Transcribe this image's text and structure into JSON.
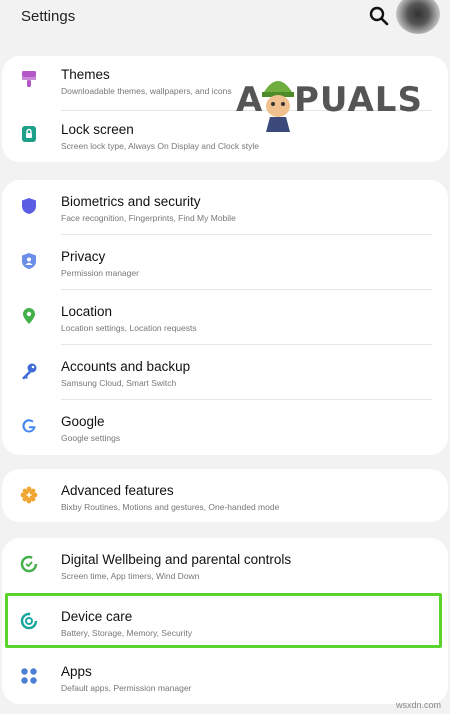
{
  "header": {
    "title": "Settings",
    "search_icon": "search-icon",
    "avatar_icon": "profile-avatar"
  },
  "watermark": {
    "a": "A",
    "rest": "PUALS"
  },
  "groups": [
    {
      "items": [
        {
          "title": "Themes",
          "subtitle": "Downloadable themes, wallpapers, and icons",
          "icon": "themes-brush-icon",
          "color": "#b357c9"
        },
        {
          "title": "Lock screen",
          "subtitle": "Screen lock type, Always On Display and Clock style",
          "icon": "lock-icon",
          "color": "#1e9f8a"
        }
      ]
    },
    {
      "items": [
        {
          "title": "Biometrics and security",
          "subtitle": "Face recognition, Fingerprints, Find My Mobile",
          "icon": "shield-icon",
          "color": "#5b5ee3"
        },
        {
          "title": "Privacy",
          "subtitle": "Permission manager",
          "icon": "privacy-shield-icon",
          "color": "#6b8ee8"
        },
        {
          "title": "Location",
          "subtitle": "Location settings, Location requests",
          "icon": "location-pin-icon",
          "color": "#43b04a"
        },
        {
          "title": "Accounts and backup",
          "subtitle": "Samsung Cloud, Smart Switch",
          "icon": "key-icon",
          "color": "#3d6ad6"
        },
        {
          "title": "Google",
          "subtitle": "Google settings",
          "icon": "google-icon",
          "color": "#4285f4"
        }
      ]
    },
    {
      "items": [
        {
          "title": "Advanced features",
          "subtitle": "Bixby Routines, Motions and gestures, One-handed mode",
          "icon": "gear-plus-icon",
          "color": "#f0a531"
        }
      ]
    },
    {
      "items": [
        {
          "title": "Digital Wellbeing and parental controls",
          "subtitle": "Screen time, App timers, Wind Down",
          "icon": "wellbeing-icon",
          "color": "#43b04a"
        },
        {
          "title": "Device care",
          "subtitle": "Battery, Storage, Memory, Security",
          "icon": "device-care-icon",
          "color": "#1aa6a0"
        },
        {
          "title": "Apps",
          "subtitle": "Default apps, Permission manager",
          "icon": "apps-grid-icon",
          "color": "#4a7fd4"
        }
      ]
    }
  ],
  "highlight_color": "#5ad32a",
  "credit": "wsxdn.com"
}
